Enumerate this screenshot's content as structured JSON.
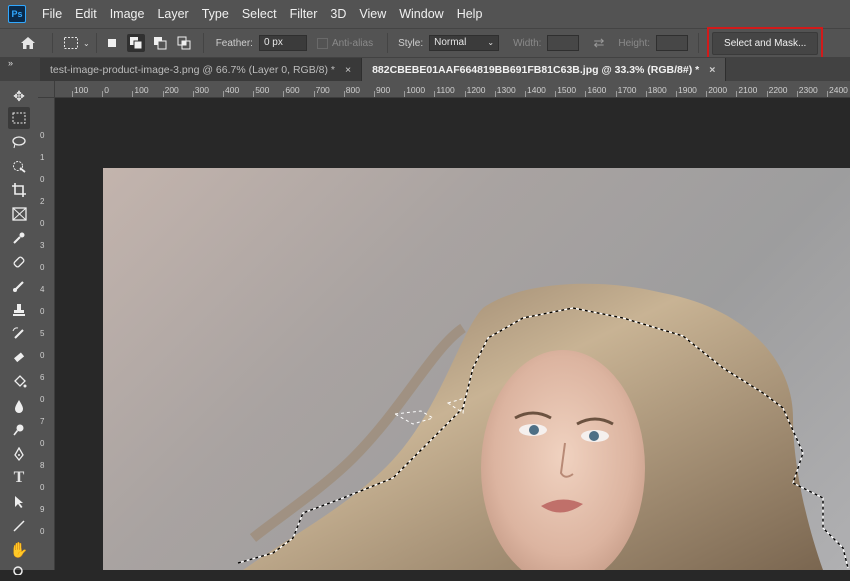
{
  "app": {
    "logo": "Ps"
  },
  "menu": [
    "File",
    "Edit",
    "Image",
    "Layer",
    "Type",
    "Select",
    "Filter",
    "3D",
    "View",
    "Window",
    "Help"
  ],
  "options": {
    "feather_label": "Feather:",
    "feather_value": "0 px",
    "antialias_label": "Anti-alias",
    "style_label": "Style:",
    "style_value": "Normal",
    "width_label": "Width:",
    "height_label": "Height:",
    "select_mask_label": "Select and Mask..."
  },
  "tabs": [
    {
      "label": "test-image-product-image-3.png @ 66.7% (Layer 0, RGB/8) *",
      "close": "×"
    },
    {
      "label": "882CBEBE01AAF664819BB691FB81C63B.jpg @ 33.3% (RGB/8#) *",
      "close": "×"
    }
  ],
  "ruler_h": [
    "100",
    "0",
    "100",
    "200",
    "300",
    "400",
    "500",
    "600",
    "700",
    "800",
    "900",
    "1000",
    "1100",
    "1200",
    "1300",
    "1400",
    "1500",
    "1600",
    "1700",
    "1800",
    "1900",
    "2000",
    "2100",
    "2200",
    "2300",
    "2400"
  ],
  "ruler_v": [
    "0",
    "1",
    "0",
    "2",
    "0",
    "3",
    "0",
    "4",
    "0",
    "5",
    "0",
    "6",
    "0",
    "7",
    "0",
    "8",
    "0",
    "9",
    "0"
  ],
  "colors": {
    "selection_highlight": "#d21a1a",
    "panel": "#535353",
    "canvas_bg": "#282828"
  },
  "icons": {
    "home": "home-icon",
    "marquee": "rect-marquee-icon",
    "new_selection": "new-selection-icon",
    "add_selection": "add-selection-icon",
    "subtract_selection": "subtract-selection-icon",
    "intersect_selection": "intersect-selection-icon",
    "swap": "swap-icon"
  }
}
